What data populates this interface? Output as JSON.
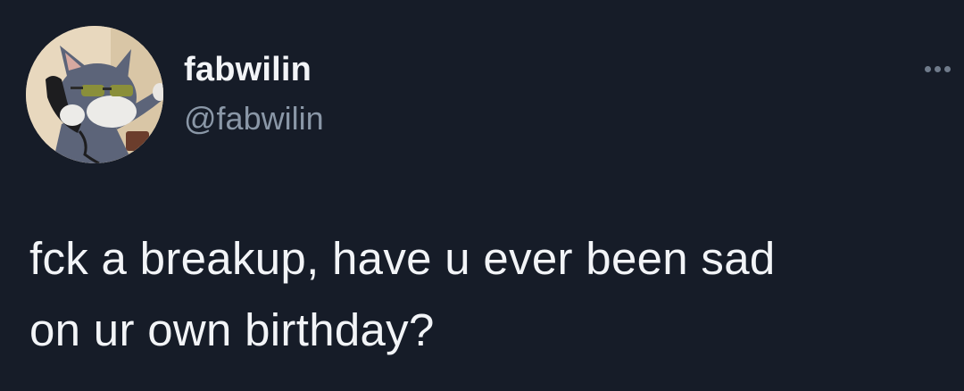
{
  "tweet": {
    "author": {
      "display_name": "fabwilin",
      "handle": "@fabwilin",
      "avatar_icon": "cartoon-cat-with-sunglasses-on-phone"
    },
    "text_line_1": "fck a breakup, have u ever been sad",
    "text_line_2": "on ur own birthday?",
    "more_icon": "more-horizontal-icon"
  },
  "colors": {
    "background": "#161c28",
    "primary_text": "#f2f4f7",
    "secondary_text": "#8a97a7",
    "icon_muted": "#6f7b8b"
  }
}
